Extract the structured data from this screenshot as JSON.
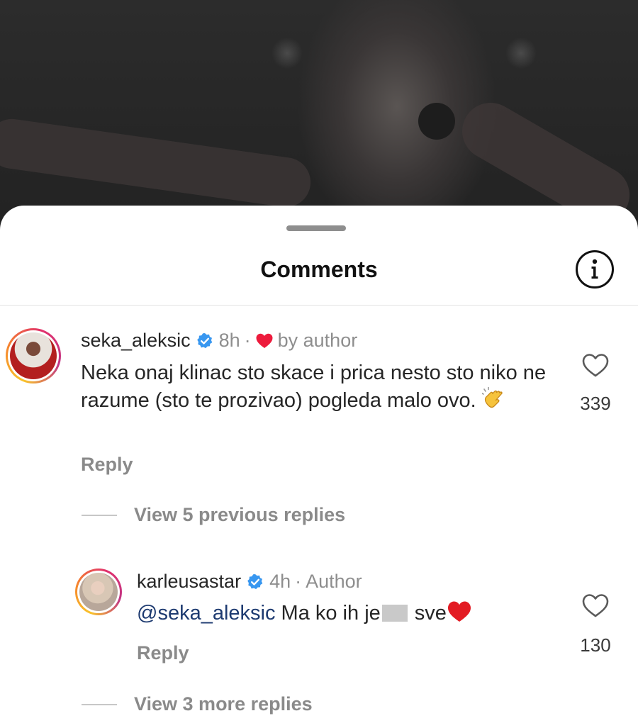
{
  "header": {
    "title": "Comments",
    "info_icon": "info-circle-icon"
  },
  "comments": [
    {
      "username": "seka_aleksic",
      "verified": true,
      "time": "8h",
      "separator": "·",
      "liked_by_author": true,
      "byline": "by author",
      "text": "Neka onaj klinac sto skace i prica nesto sto niko ne razume (sto te prozivao) pogleda malo ovo.",
      "emoji": "clapping-hands-emoji",
      "reply_label": "Reply",
      "like_count": "339",
      "view_replies_label": "View 5 previous replies"
    }
  ],
  "replies": [
    {
      "username": "karleusastar",
      "verified": true,
      "time": "4h",
      "separator": "·",
      "badge": "Author",
      "mention": "@seka_aleksic",
      "text_before_censor": "Ma ko ih je",
      "text_after_censor": "sve",
      "emoji": "red-heart-emoji",
      "reply_label": "Reply",
      "like_count": "130",
      "view_more_label": "View 3 more replies"
    }
  ],
  "colors": {
    "mention": "#1d3a70",
    "verified": "#3897f0",
    "heart": "#ed1b3c",
    "muted": "#8e8e8e"
  }
}
